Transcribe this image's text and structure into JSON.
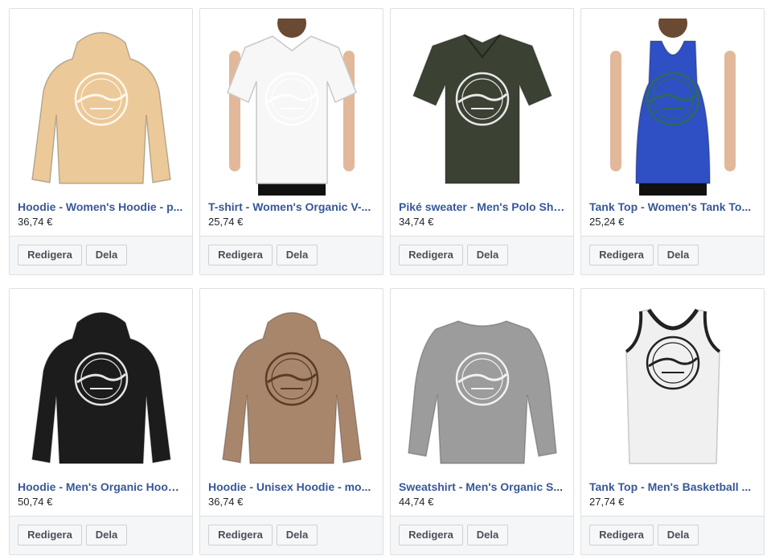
{
  "products": [
    {
      "title": "Hoodie - Women's Hoodie - p...",
      "price": "36,74 €",
      "edit_label": "Redigera",
      "share_label": "Dela",
      "garment": "hoodie",
      "color": "#ecc998",
      "print_color": "#fff8ee",
      "model": false
    },
    {
      "title": "T-shirt - Women's Organic V-...",
      "price": "25,74 €",
      "edit_label": "Redigera",
      "share_label": "Dela",
      "garment": "tshirt",
      "color": "#f7f7f7",
      "print_color": "#ffffff",
      "model": true
    },
    {
      "title": "Piké sweater - Men's Polo Shi...",
      "price": "34,74 €",
      "edit_label": "Redigera",
      "share_label": "Dela",
      "garment": "polo",
      "color": "#3b4133",
      "print_color": "#e8e8e8",
      "model": false
    },
    {
      "title": "Tank Top - Women's Tank To...",
      "price": "25,24 €",
      "edit_label": "Redigera",
      "share_label": "Dela",
      "garment": "tank",
      "color": "#2f4fc4",
      "print_color": "#2d6a5a",
      "model": true
    },
    {
      "title": "Hoodie - Men's Organic Hood...",
      "price": "50,74 €",
      "edit_label": "Redigera",
      "share_label": "Dela",
      "garment": "hoodie",
      "color": "#1c1c1c",
      "print_color": "#e5e5e5",
      "model": false
    },
    {
      "title": "Hoodie - Unisex Hoodie - mo...",
      "price": "36,74 €",
      "edit_label": "Redigera",
      "share_label": "Dela",
      "garment": "hoodie",
      "color": "#a8866c",
      "print_color": "#5a3b26",
      "model": false
    },
    {
      "title": "Sweatshirt - Men's Organic S...",
      "price": "44,74 €",
      "edit_label": "Redigera",
      "share_label": "Dela",
      "garment": "sweatshirt",
      "color": "#9c9c9c",
      "print_color": "#f2f2f2",
      "model": false
    },
    {
      "title": "Tank Top - Men's Basketball ...",
      "price": "27,74 €",
      "edit_label": "Redigera",
      "share_label": "Dela",
      "garment": "basketball",
      "color": "#f0f0f0",
      "print_color": "#222222",
      "model": false
    }
  ]
}
